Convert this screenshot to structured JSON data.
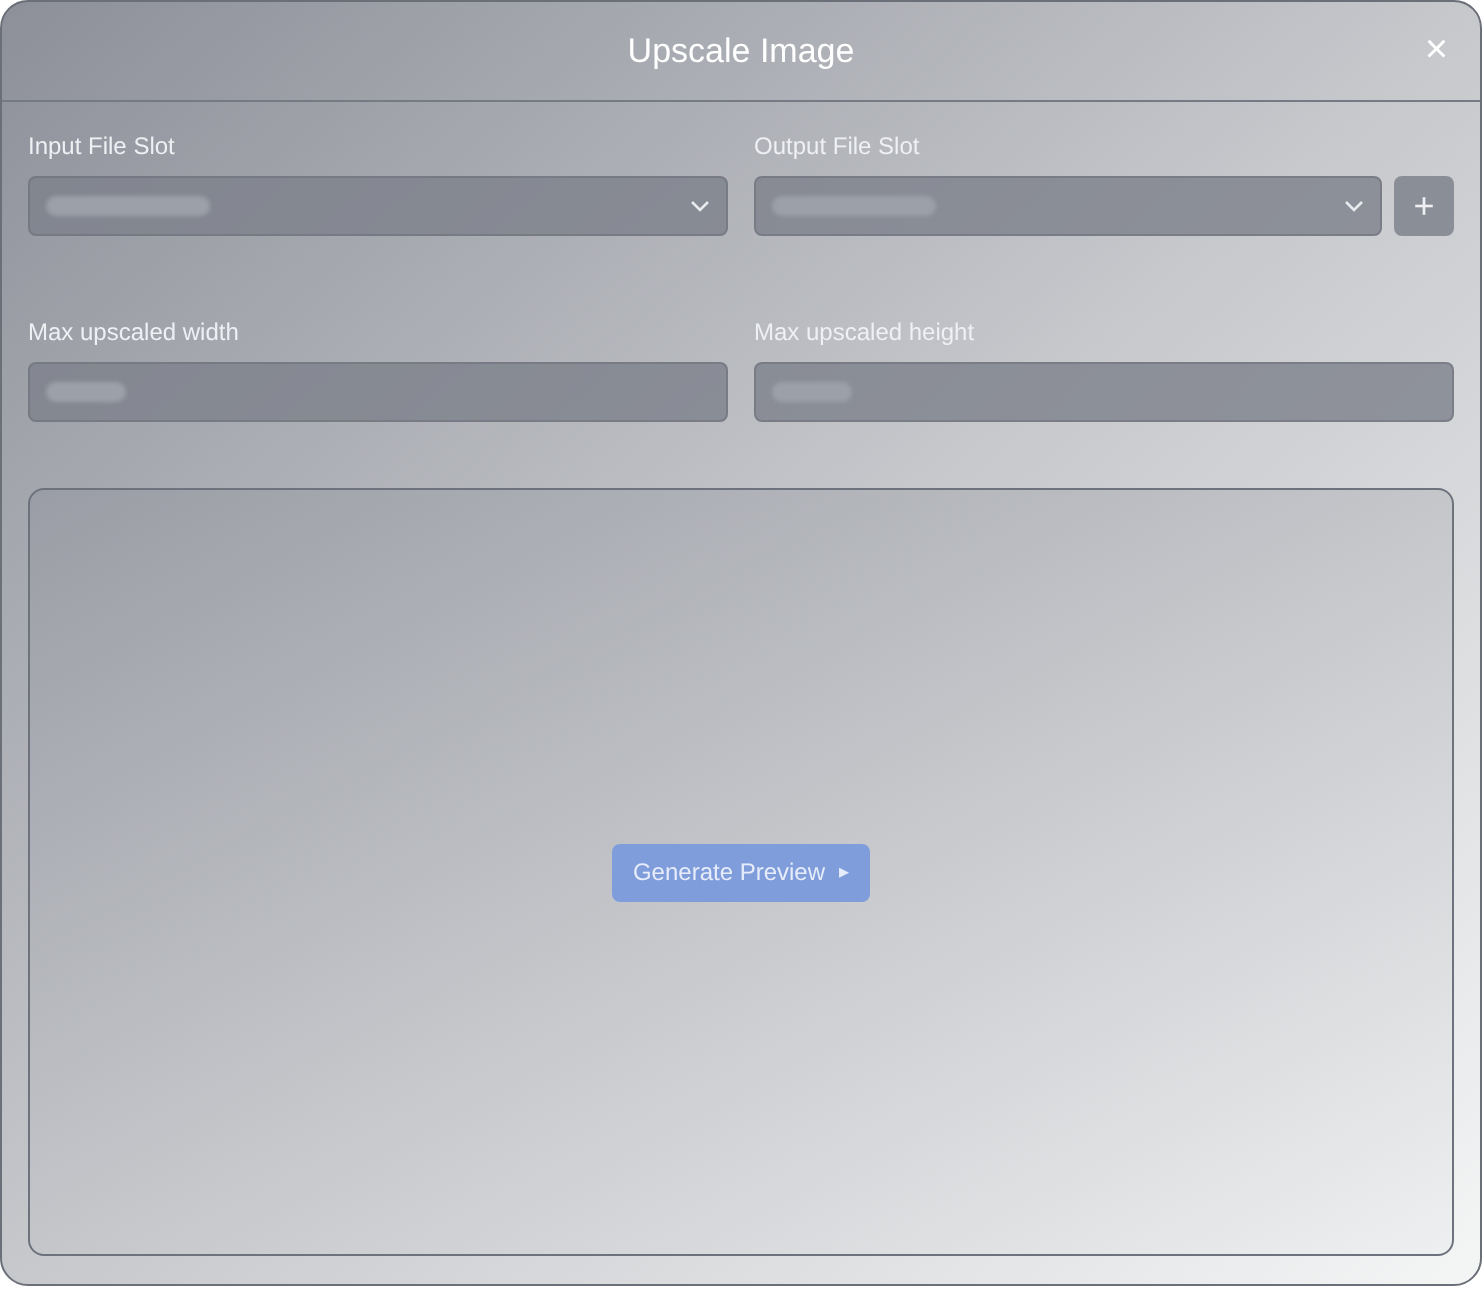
{
  "window": {
    "title": "Upscale Image",
    "close": "×"
  },
  "fields": [
    {
      "label": "Input File Slot",
      "kind": "select",
      "loading": true
    },
    {
      "label": "Output File Slot",
      "kind": "select",
      "loading": true,
      "add_button": "+"
    },
    {
      "label": "Max upscaled width",
      "kind": "input",
      "loading": true
    },
    {
      "label": "Max upscaled height",
      "kind": "input",
      "loading": true
    }
  ],
  "preview": {
    "button": {
      "label": "Generate Preview",
      "icon": "▸",
      "disabled": true
    }
  }
}
